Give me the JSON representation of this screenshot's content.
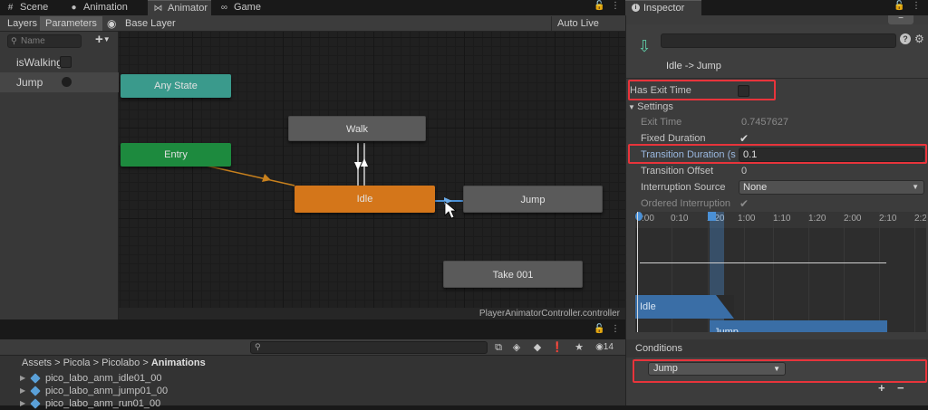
{
  "tabs": [
    {
      "label": "Scene",
      "icon": "hash-icon"
    },
    {
      "label": "Animation",
      "icon": "play-circle-icon"
    },
    {
      "label": "Animator",
      "icon": "animator-icon"
    },
    {
      "label": "Game",
      "icon": "gamepad-icon"
    }
  ],
  "animator": {
    "toolbar": {
      "layers_label": "Layers",
      "parameters_label": "Parameters",
      "base_layer_label": "Base Layer",
      "auto_live_link_label": "Auto Live Link"
    },
    "search_placeholder": "Name",
    "parameters": [
      {
        "name": "isWalking",
        "type": "bool"
      },
      {
        "name": "Jump",
        "type": "trigger"
      }
    ],
    "states": {
      "any_state": "Any State",
      "entry": "Entry",
      "walk": "Walk",
      "idle": "Idle",
      "jump": "Jump",
      "take001": "Take 001"
    },
    "controller_name": "PlayerAnimatorController.controller",
    "colors": {
      "any_state": "#3a9a8c",
      "entry": "#1d8a3e",
      "idle": "#d4761a",
      "transition": "#4a90d6"
    }
  },
  "project": {
    "item_count": "14",
    "breadcrumb": [
      "Assets",
      "Picola",
      "Picolabo",
      "Animations"
    ],
    "assets": [
      "pico_labo_anm_idle01_00",
      "pico_labo_anm_jump01_00",
      "pico_labo_anm_run01_00"
    ]
  },
  "inspector": {
    "tab_label": "Inspector",
    "transition_title": "Idle -> Jump",
    "has_exit_time_label": "Has Exit Time",
    "has_exit_time": false,
    "settings_label": "Settings",
    "exit_time_label": "Exit Time",
    "exit_time_value": "0.7457627",
    "fixed_duration_label": "Fixed Duration",
    "transition_duration_label": "Transition Duration (s",
    "transition_duration_value": "0.1",
    "transition_offset_label": "Transition Offset",
    "transition_offset_value": "0",
    "interruption_source_label": "Interruption Source",
    "interruption_source_value": "None",
    "ordered_interruption_label": "Ordered Interruption",
    "timeline_ticks": [
      "0:00",
      "0:10",
      "1:00",
      "1:10",
      "1:20",
      "2:00",
      "2:10",
      "2:20"
    ],
    "timeline_ticks_display": [
      ":00",
      "0:10",
      "1:20",
      "1:00",
      "1:10",
      "1:20",
      "2:00",
      "2:10",
      "2:20"
    ],
    "timeline_idle_label": "Idle",
    "timeline_jump_label": "Jump",
    "conditions_label": "Conditions",
    "condition_value": "Jump",
    "add_label": "+",
    "remove_label": "−"
  }
}
